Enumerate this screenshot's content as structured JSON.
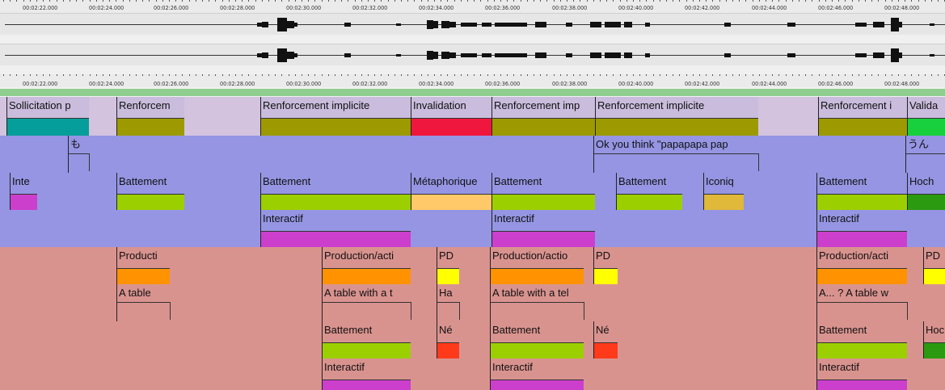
{
  "ruler": {
    "ticks": [
      "00:02:22.000",
      "00:02:24.000",
      "00:02:26.000",
      "00:02:28.000",
      "00:02:30.000",
      "00:02:32.000",
      "00:02:34.000",
      "00:02:36.000",
      "00:02:38.000",
      "00:02:40.000",
      "00:02:42.000",
      "00:02:44.000",
      "00:02:46.000",
      "00:02:48.000"
    ]
  },
  "colors": {
    "tier_purple": "#c4b6e0",
    "tier_blue": "#9595e3",
    "tier_pink": "#d9938f",
    "olive": "#9c9a00",
    "teal": "#069e9a",
    "red": "#f0173f",
    "lime": "#9ccf00",
    "peach": "#ffc868",
    "gold": "#e0b83a",
    "magenta": "#cc3fcc",
    "orange": "#ff9200",
    "yellow": "#ffff00",
    "red_orange": "#ff3a1a",
    "green": "#18cf3e",
    "dark_green": "#2c9a10"
  },
  "tiers": [
    {
      "name": "tier-feedback",
      "bg": "#9595e3",
      "annotations": [
        {
          "label": "Sollicitation p",
          "color": "#069e9a"
        },
        {
          "label": "Renforcem",
          "color": "#9c9a00"
        },
        {
          "label": "Renforcement implicite",
          "color": "#9c9a00"
        },
        {
          "label": "Invalidation",
          "color": "#f0173f"
        },
        {
          "label": "Renforcement imp",
          "color": "#9c9a00"
        },
        {
          "label": "Renforcement implicite",
          "color": "#9c9a00"
        },
        {
          "label": "Renforcement i",
          "color": "#9c9a00"
        },
        {
          "label": "Valida",
          "color": "#18cf3e"
        }
      ]
    },
    {
      "name": "tier-transcription-teacher",
      "bg": "#9595e3",
      "annotations": [
        {
          "label": "も",
          "color": ""
        },
        {
          "label": "Ok you think \"papapapa pap",
          "color": ""
        },
        {
          "label": "うん",
          "color": ""
        }
      ]
    },
    {
      "name": "tier-gesture-teacher",
      "bg": "#9595e3",
      "annotations": [
        {
          "label": "Inte",
          "color": "#cc3fcc"
        },
        {
          "label": "Battement",
          "color": "#9ccf00"
        },
        {
          "label": "Battement",
          "color": "#9ccf00"
        },
        {
          "label": "Métaphorique",
          "color": "#ffc868"
        },
        {
          "label": "Battement",
          "color": "#9ccf00"
        },
        {
          "label": "Battement",
          "color": "#9ccf00"
        },
        {
          "label": "Iconiq",
          "color": "#e0b83a"
        },
        {
          "label": "Battement",
          "color": "#9ccf00"
        },
        {
          "label": "Hoch",
          "color": "#2c9a10"
        }
      ]
    },
    {
      "name": "tier-function-teacher",
      "bg": "#9595e3",
      "annotations": [
        {
          "label": "Interactif",
          "color": "#cc3fcc"
        },
        {
          "label": "Interactif",
          "color": "#cc3fcc"
        },
        {
          "label": "Interactif",
          "color": "#cc3fcc"
        }
      ]
    },
    {
      "name": "tier-action-learner",
      "bg": "#d9938f",
      "annotations": [
        {
          "label": "Producti",
          "color": "#ff9200"
        },
        {
          "label": "Production/acti",
          "color": "#ff9200"
        },
        {
          "label": "PD",
          "color": "#ffff00"
        },
        {
          "label": "Production/actio",
          "color": "#ff9200"
        },
        {
          "label": "PD",
          "color": "#ffff00"
        },
        {
          "label": "Production/acti",
          "color": "#ff9200"
        },
        {
          "label": "PD",
          "color": "#ffff00"
        }
      ]
    },
    {
      "name": "tier-transcription-learner",
      "bg": "#d9938f",
      "annotations": [
        {
          "label": "A table",
          "color": ""
        },
        {
          "label": "A table with a t",
          "color": ""
        },
        {
          "label": "Ha",
          "color": ""
        },
        {
          "label": "A table with a tel",
          "color": ""
        },
        {
          "label": "A... ? A table w",
          "color": ""
        }
      ]
    },
    {
      "name": "tier-gesture-learner",
      "bg": "#d9938f",
      "annotations": [
        {
          "label": "Battement",
          "color": "#9ccf00"
        },
        {
          "label": "Né",
          "color": "#ff3a1a"
        },
        {
          "label": "Battement",
          "color": "#9ccf00"
        },
        {
          "label": "Né",
          "color": "#ff3a1a"
        },
        {
          "label": "Battement",
          "color": "#9ccf00"
        },
        {
          "label": "Hoc",
          "color": "#2c9a10"
        }
      ]
    },
    {
      "name": "tier-function-learner",
      "bg": "#d9938f",
      "annotations": [
        {
          "label": "Interactif",
          "color": "#cc3fcc"
        },
        {
          "label": "Interactif",
          "color": "#cc3fcc"
        },
        {
          "label": "Interactif",
          "color": "#cc3fcc"
        }
      ]
    }
  ]
}
